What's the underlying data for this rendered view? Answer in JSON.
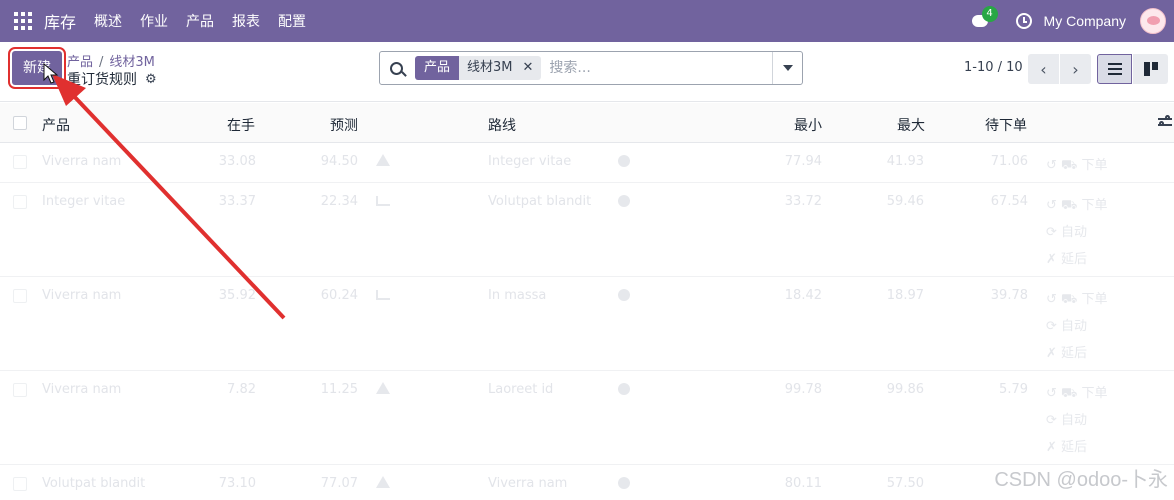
{
  "navbar": {
    "app_name": "库存",
    "menu": [
      "概述",
      "作业",
      "产品",
      "报表",
      "配置"
    ],
    "chat_badge": "4",
    "company": "My Company"
  },
  "control": {
    "new_label": "新建",
    "breadcrumb_parent": "产品",
    "breadcrumb_current": "线材3M",
    "page_title": "重订货规则",
    "search": {
      "facet_label": "产品",
      "facet_value": "线材3M",
      "placeholder": "搜索..."
    },
    "pager": "1-10 / 10"
  },
  "table": {
    "headers": {
      "product": "产品",
      "on_hand": "在手",
      "forecast": "预测",
      "route": "路线",
      "min": "最小",
      "max": "最大",
      "to_order": "待下单"
    },
    "rows": [
      {
        "product": "Viverra nam",
        "on_hand": "33.08",
        "forecast": "94.50",
        "forecast_icon": "warning-icon",
        "route": "Integer vitae",
        "min": "77.94",
        "max": "41.93",
        "to_order": "71.06",
        "actions": [
          "下单"
        ]
      },
      {
        "product": "Integer vitae",
        "on_hand": "33.37",
        "forecast": "22.34",
        "forecast_icon": "chart-icon",
        "route": "Volutpat blandit",
        "min": "33.72",
        "max": "59.46",
        "to_order": "67.54",
        "actions": [
          "下单",
          "自动",
          "延后"
        ]
      },
      {
        "product": "Viverra nam",
        "on_hand": "35.92",
        "forecast": "60.24",
        "forecast_icon": "chart-icon",
        "route": "In massa",
        "min": "18.42",
        "max": "18.97",
        "to_order": "39.78",
        "actions": [
          "下单",
          "自动",
          "延后"
        ]
      },
      {
        "product": "Viverra nam",
        "on_hand": "7.82",
        "forecast": "11.25",
        "forecast_icon": "warning-icon",
        "route": "Laoreet id",
        "min": "99.78",
        "max": "99.86",
        "to_order": "5.79",
        "actions": [
          "下单",
          "自动",
          "延后"
        ]
      },
      {
        "product": "Volutpat blandit",
        "on_hand": "73.10",
        "forecast": "77.07",
        "forecast_icon": "warning-icon",
        "route": "Viverra nam",
        "min": "80.11",
        "max": "57.50",
        "to_order": "",
        "actions": []
      }
    ]
  },
  "watermark": "CSDN @odoo-卜永",
  "colors": {
    "brand": "#71639e",
    "annotation": "#e0302f",
    "badge": "#28a745"
  }
}
